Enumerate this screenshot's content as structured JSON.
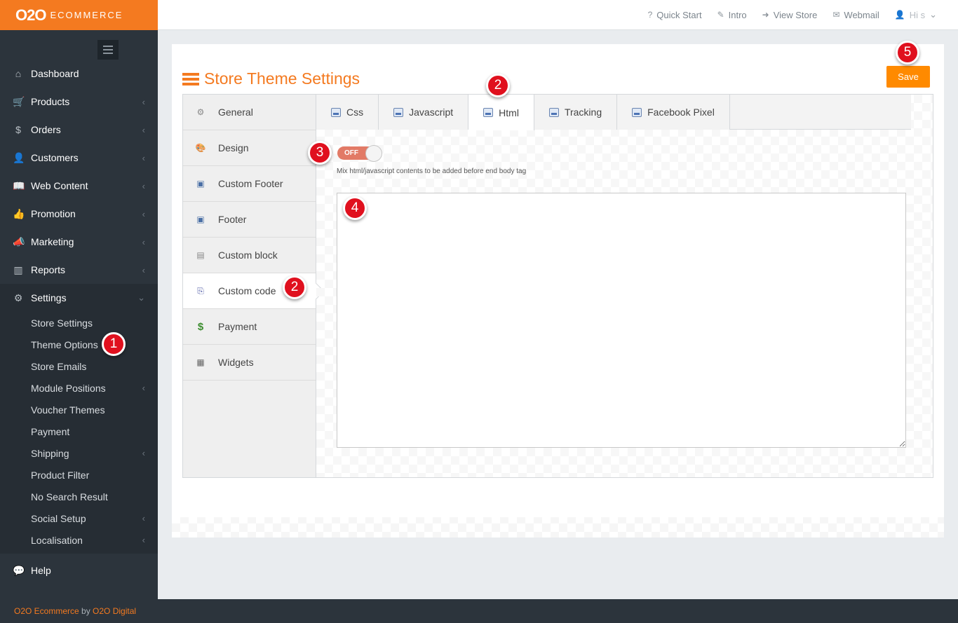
{
  "brand": {
    "logo_main": "O2O",
    "logo_sub": "ECOMMERCE"
  },
  "topbar": {
    "links": [
      {
        "icon": "?",
        "label": "Quick Start"
      },
      {
        "icon": "✎",
        "label": "Intro"
      },
      {
        "icon": "➜",
        "label": "View Store"
      },
      {
        "icon": "✉",
        "label": "Webmail"
      },
      {
        "icon": "👤",
        "label": "Hi s"
      }
    ],
    "user_chevron": "⌄"
  },
  "sidebar": {
    "items": [
      {
        "icon": "⌂",
        "label": "Dashboard"
      },
      {
        "icon": "🛒",
        "label": "Products"
      },
      {
        "icon": "$",
        "label": "Orders"
      },
      {
        "icon": "👤",
        "label": "Customers"
      },
      {
        "icon": "📖",
        "label": "Web Content"
      },
      {
        "icon": "👍",
        "label": "Promotion"
      },
      {
        "icon": "📣",
        "label": "Marketing"
      },
      {
        "icon": "▥",
        "label": "Reports"
      },
      {
        "icon": "⚙",
        "label": "Settings"
      }
    ],
    "settings_sub": [
      "Store Settings",
      "Theme Options",
      "Store Emails",
      "Module Positions",
      "Voucher Themes",
      "Payment",
      "Shipping",
      "Product Filter",
      "No Search Result",
      "Social Setup",
      "Localisation"
    ],
    "help": {
      "icon": "💬",
      "label": "Help"
    }
  },
  "page": {
    "title": "Store Theme Settings",
    "save_label": "Save"
  },
  "left_tabs": [
    {
      "icon": "⚙",
      "label": "General"
    },
    {
      "icon": "🎨",
      "label": "Design"
    },
    {
      "icon": "▣",
      "label": "Custom Footer"
    },
    {
      "icon": "▣",
      "label": "Footer"
    },
    {
      "icon": "▤",
      "label": "Custom block"
    },
    {
      "icon": "⎘",
      "label": "Custom code"
    },
    {
      "icon": "$",
      "label": "Payment"
    },
    {
      "icon": "▦",
      "label": "Widgets"
    }
  ],
  "top_tabs": [
    "Css",
    "Javascript",
    "Html",
    "Tracking",
    "Facebook Pixel"
  ],
  "html_tab": {
    "toggle_label": "OFF",
    "help_text": "Mix html/javascript contents to be added before end body tag",
    "code_value": ""
  },
  "callouts": [
    "1",
    "2",
    "2",
    "3",
    "4",
    "5"
  ],
  "footer": {
    "brand": "O2O Ecommerce",
    "by": " by ",
    "company": "O2O Digital"
  },
  "colors": {
    "brand_orange": "#f47a20",
    "sidebar_bg": "#2c343c",
    "save_button": "#ff8a00",
    "callout_red": "#e0101e",
    "toggle_off": "#e27a66"
  }
}
